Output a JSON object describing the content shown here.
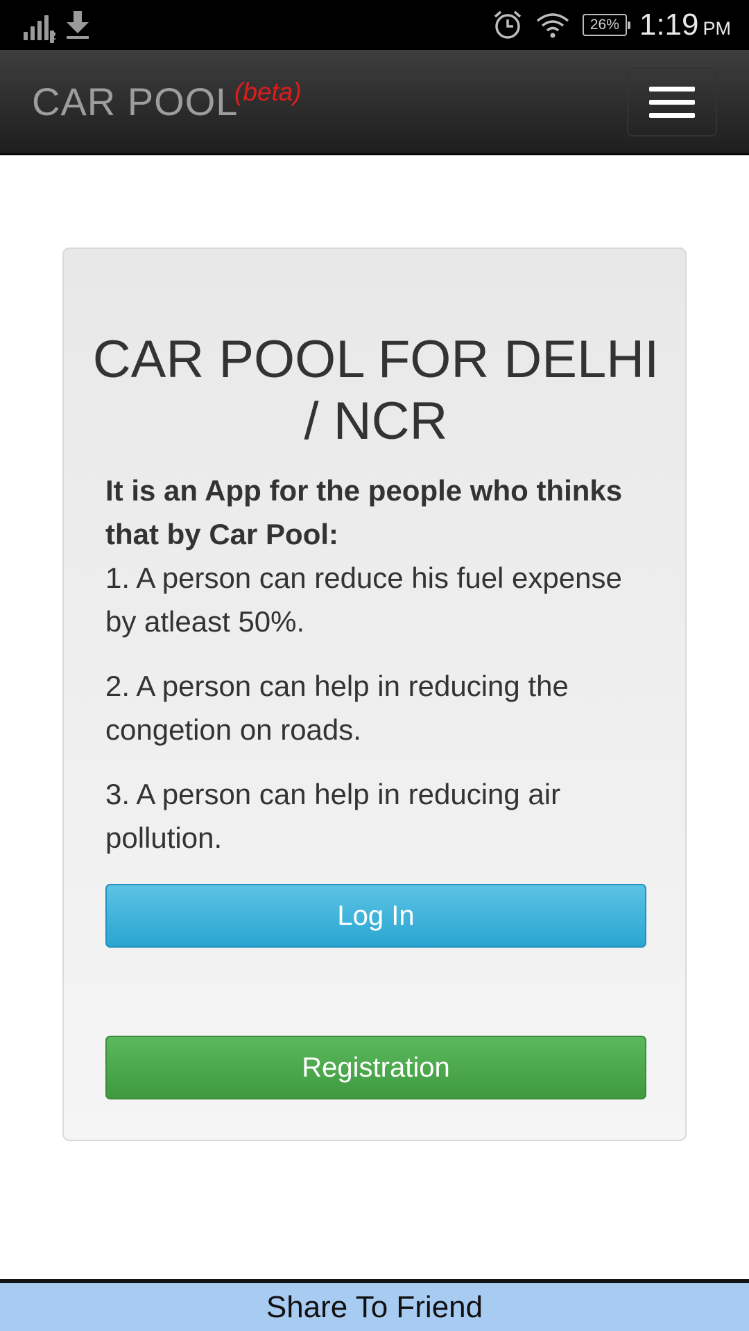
{
  "status_bar": {
    "sim_index": "2",
    "battery": "26%",
    "time": "1:19",
    "ampm": "PM",
    "icons": [
      "signal-icon",
      "download-icon",
      "alarm-icon",
      "wifi-icon",
      "battery-icon"
    ]
  },
  "navbar": {
    "brand": "CAR POOL",
    "badge": "(beta)",
    "menu_icon": "hamburger-menu-icon"
  },
  "card": {
    "title": "CAR POOL FOR DELHI / NCR",
    "intro": "It is an App for the people who thinks that by Car Pool:",
    "points": [
      "1. A person can reduce his fuel expense by atleast 50%.",
      "2. A person can help in reducing the congetion on roads.",
      "3. A person can help in reducing air pollution."
    ],
    "login_label": "Log In",
    "register_label": "Registration"
  },
  "footer": {
    "share_label": "Share To Friend"
  },
  "colors": {
    "login": "#39b3d7",
    "register": "#47a447",
    "beta": "#e01b1b",
    "share_bar": "#a8cbf2"
  }
}
